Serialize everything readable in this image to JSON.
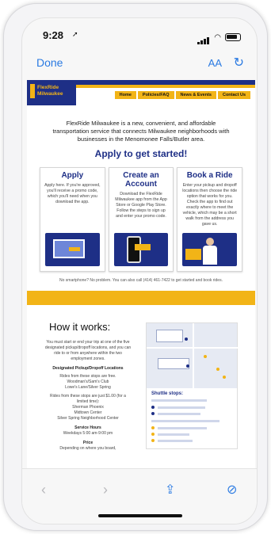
{
  "status": {
    "time": "9:28",
    "location_icon": "location-arrow-icon"
  },
  "browser": {
    "done_label": "Done",
    "text_size_label": "AA",
    "reload_icon": "reload-icon"
  },
  "site": {
    "logo_line1": "FlexRide",
    "logo_line2": "Milwaukee",
    "menu": [
      "Home",
      "Policies/FAQ",
      "News & Events",
      "Contact Us"
    ],
    "intro": "FlexRide Milwaukee is a new, convenient, and affordable transportation service that connects Milwaukee neighborhoods with businesses in the Menomonee Falls/Butler area.",
    "apply_heading": "Apply to get started!",
    "cards": [
      {
        "title": "Apply",
        "text": "Apply here. If you're approved, you'll receive a promo code, which you'll need when you download the app."
      },
      {
        "title": "Create an Account",
        "text": "Download the FlexRide Milwaukee app from the App Store or Google Play Store. Follow the steps to sign up and enter your promo code."
      },
      {
        "title": "Book a Ride",
        "text": "Enter your pickup and dropoff locations then choose the ride option that works for you. Check the app to find out exactly where to meet the vehicle, which may be a short walk from the address you gave us."
      }
    ],
    "note": "No smartphone? No problem. You can also call (414) 461-7422 to get started and book rides.",
    "how_title": "How it works:",
    "how_intro": "You must start or end your trip at one of the five designated pickup/dropoff locations, and you can ride to or from anywhere within the two employment zones.",
    "designated_heading": "Designated Pickup/Dropoff Locations",
    "rides_free": "Rides from these stops are free.",
    "free_stops": [
      "Woodman's/Sam's Club",
      "Lowe's Lane/Silver Spring"
    ],
    "paid_intro": "Rides from these stops are just $1.00 (for a limited time):",
    "paid_stops": [
      "Sherman Phoenix",
      "Midtown Center",
      "Silver Spring Neighborhood Center"
    ],
    "service_hours_heading": "Service Hours",
    "service_hours": "Weekdays 5:00 am-9:00 pm",
    "price_heading": "Price",
    "price_text": "Depending on where you board,",
    "map_stops_title": "Shuttle stops:"
  },
  "toolbar": {
    "back_icon": "back-icon",
    "forward_icon": "forward-icon",
    "share_icon": "share-icon",
    "compass_icon": "compass-icon"
  },
  "colors": {
    "brand_blue": "#1e2f86",
    "brand_yellow": "#f2b417",
    "ios_blue": "#2a7ae2"
  }
}
